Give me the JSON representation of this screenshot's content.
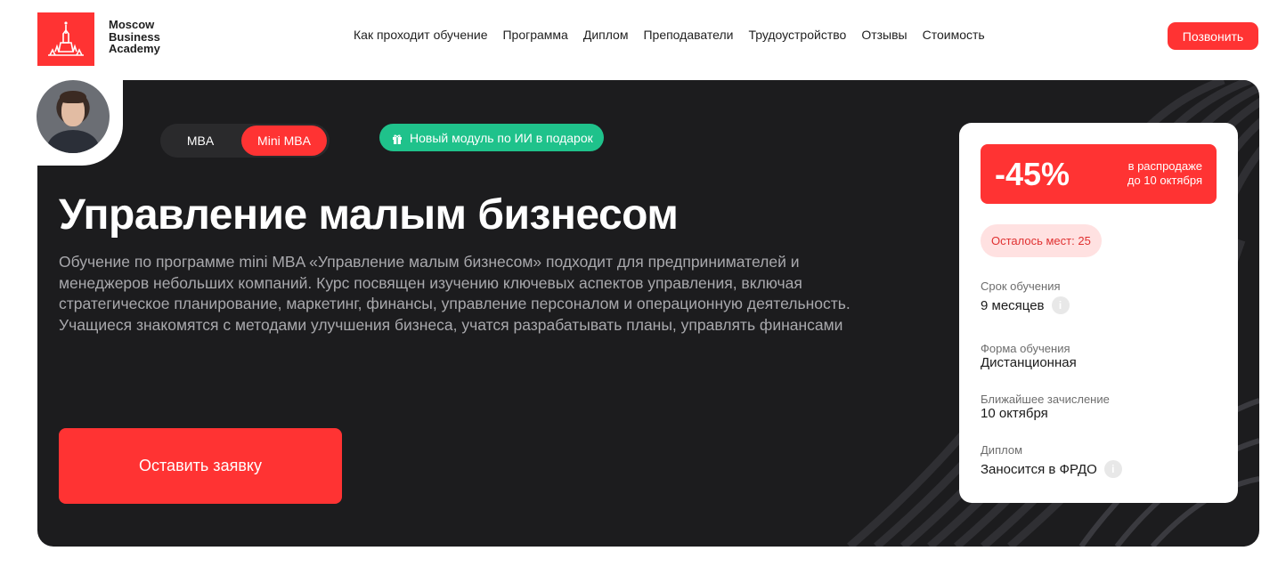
{
  "header": {
    "logo_text": "Moscow Business Academy",
    "nav": [
      "Как проходит обучение",
      "Программа",
      "Диплом",
      "Преподаватели",
      "Трудоустройство",
      "Отзывы",
      "Стоимость"
    ],
    "call_button": "Позвонить"
  },
  "hero": {
    "tabs": [
      "MBA",
      "Mini MBA"
    ],
    "active_tab": "Mini MBA",
    "gift_badge": "Новый модуль по ИИ в подарок",
    "title": "Управление малым бизнесом",
    "description": "Обучение по программе mini MBA «Управление малым бизнесом» подходит для предпринимателей и менеджеров небольших компаний. Курс посвящен изучению ключевых аспектов управления, включая стратегическое планирование, маркетинг, финансы, управление персоналом и операционную деятельность. Учащиеся знакомятся с методами улучшения бизнеса, учатся разрабатывать планы, управлять финансами",
    "apply_button": "Оставить заявку"
  },
  "card": {
    "discount": "-45%",
    "discount_note_line1": "в распродаже",
    "discount_note_line2": "до 10 октября",
    "seats": "Осталось мест: 25",
    "duration_label": "Срок обучения",
    "duration_value": "9 месяцев",
    "form_label": "Форма обучения",
    "form_value": "Дистанционная",
    "enroll_label": "Ближайшее зачисление",
    "enroll_value": "10 октября",
    "diploma_label": "Диплом",
    "diploma_value": "Заносится в ФРДО"
  },
  "colors": {
    "accent": "#ff3333",
    "dark": "#1c1c1e",
    "green": "#1fc28b"
  }
}
